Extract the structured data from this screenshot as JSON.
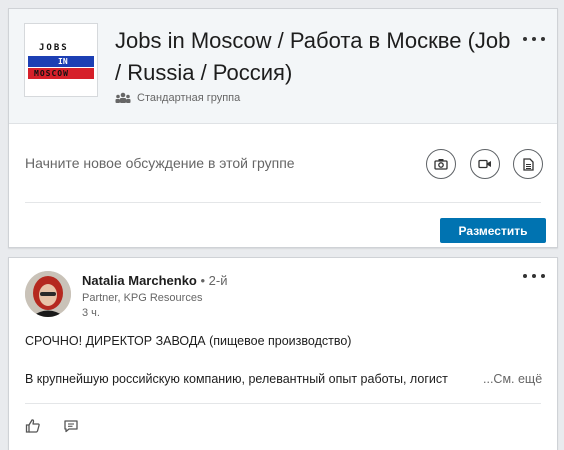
{
  "group": {
    "logo": {
      "line1": "JOBS",
      "line2": "IN",
      "line3": "MOSCOW",
      "colors": {
        "blue": "#1c3fb4",
        "red": "#d6202a"
      }
    },
    "title": "Jobs in Moscow / Работа в Москве (Job / Russia / Россия)",
    "type_label": "Стандартная группа",
    "icons": {
      "type": "people-group-icon",
      "more": "more-dots-icon"
    }
  },
  "compose": {
    "placeholder": "Начните новое обсуждение в этой группе",
    "buttons": [
      {
        "name": "camera",
        "icon": "camera-icon"
      },
      {
        "name": "video",
        "icon": "video-camera-icon"
      },
      {
        "name": "document",
        "icon": "document-icon"
      }
    ],
    "post_label": "Разместить",
    "accent": "#0073b1"
  },
  "post": {
    "author_name": "Natalia Marchenko",
    "degree": " • 2-й",
    "headline": "Partner, KPG Resources",
    "time": "3 ч.",
    "line1": "СРОЧНО! ДИРЕКТОР ЗАВОДА (пищевое производство)",
    "line2": "В крупнейшую российскую компанию, релевантный опыт работы, логист",
    "see_more": "...См. ещё",
    "actions": {
      "like_icon": "thumbs-up-icon",
      "comment_icon": "comment-icon"
    }
  }
}
